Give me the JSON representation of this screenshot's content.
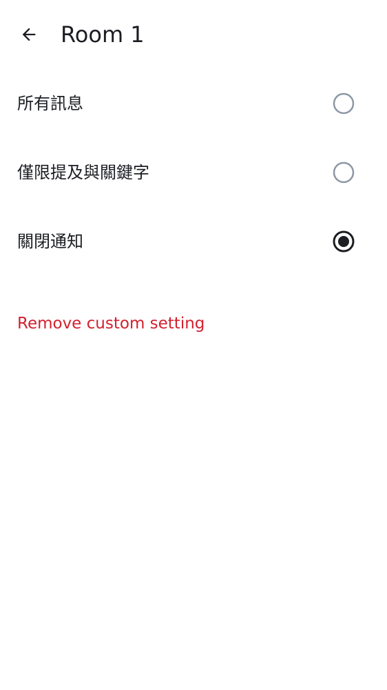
{
  "header": {
    "title": "Room 1",
    "back_icon": "arrow-back-icon"
  },
  "options": [
    {
      "label": "所有訊息",
      "selected": false
    },
    {
      "label": "僅限提及與關鍵字",
      "selected": false
    },
    {
      "label": "關閉通知",
      "selected": true
    }
  ],
  "remove_link": {
    "label": "Remove custom setting"
  },
  "colors": {
    "text_primary": "#1b1d22",
    "radio_unselected": "#8d97a5",
    "radio_selected": "#1b1d22",
    "destructive": "#d31f2e",
    "background": "#ffffff"
  }
}
